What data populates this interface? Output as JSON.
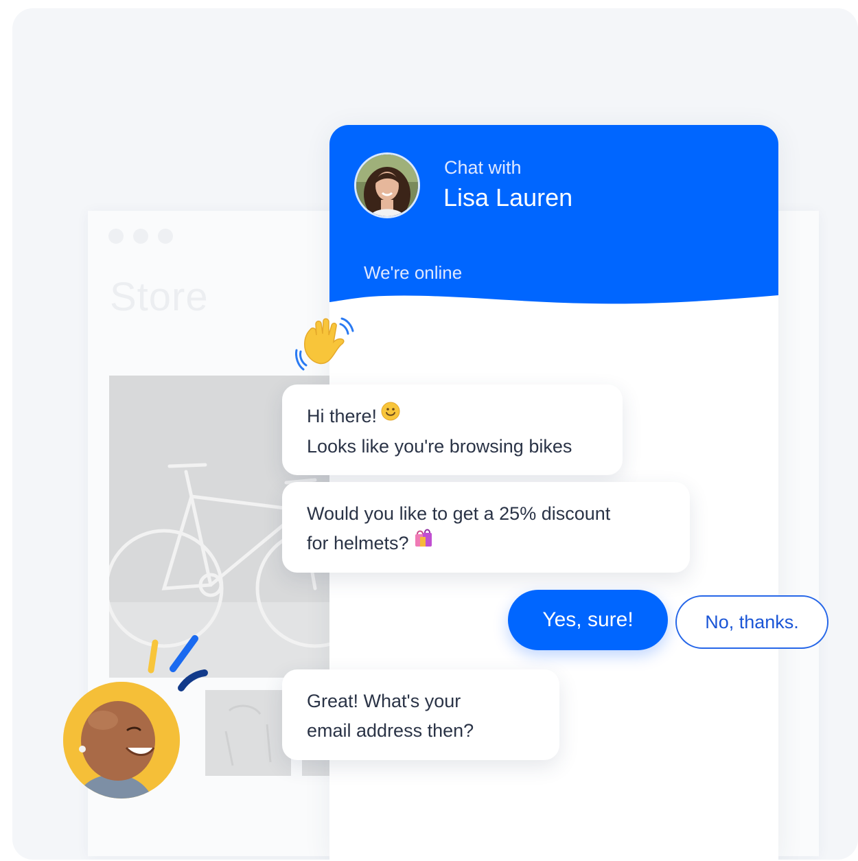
{
  "store": {
    "title": "Store"
  },
  "chat": {
    "header": {
      "intro": "Chat with",
      "agent_name": "Lisa Lauren",
      "status": "We're online",
      "color": "#0066ff"
    },
    "messages": [
      {
        "sender": "agent",
        "lines": [
          "Hi there!",
          "Looks like you're browsing bikes"
        ],
        "emoji": "smiling-face-icon"
      },
      {
        "sender": "agent",
        "lines": [
          "Would you like to get a 25% discount",
          "for helmets?"
        ],
        "emoji": "shopping-bags-icon"
      },
      {
        "sender": "agent",
        "lines": [
          "Great! What's your",
          "email address then?"
        ]
      }
    ],
    "quick_replies": {
      "yes": "Yes, sure!",
      "no": "No, thanks."
    }
  },
  "icons": {
    "wave": "waving-hand-icon",
    "agent_avatar": "agent-avatar",
    "visitor_avatar": "visitor-avatar"
  },
  "colors": {
    "accent": "#0066ff",
    "background": "#f4f6f9",
    "text": "#2a3346"
  }
}
